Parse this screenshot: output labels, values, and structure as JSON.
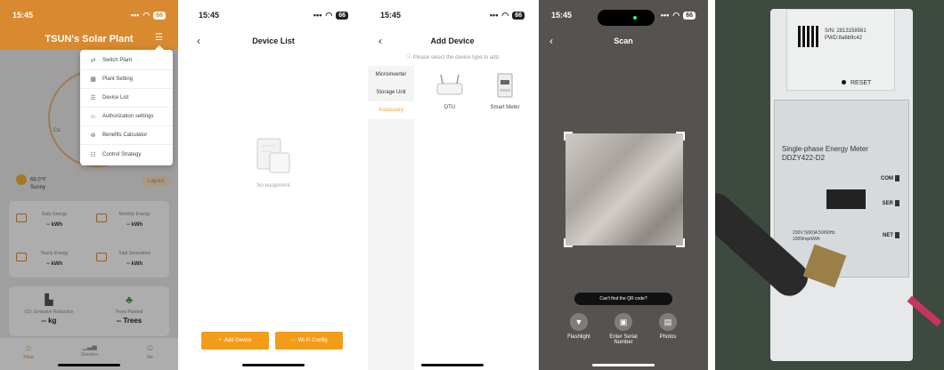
{
  "status_bar": {
    "time": "15:45",
    "signal": "•••",
    "wifi": "◠",
    "battery": "66"
  },
  "panel1": {
    "title": "TSUN's Solar Plant",
    "menu": [
      {
        "icon": "switch-icon",
        "glyph": "⇄",
        "label": "Switch Plant"
      },
      {
        "icon": "plant-setting-icon",
        "glyph": "▦",
        "label": "Plant Setting"
      },
      {
        "icon": "device-list-icon",
        "glyph": "☰",
        "label": "Device List"
      },
      {
        "icon": "user-icon",
        "glyph": "☺",
        "label": "Authorization settings"
      },
      {
        "icon": "calculator-icon",
        "glyph": "⊛",
        "label": "Benefits Calculator"
      },
      {
        "icon": "strategy-icon",
        "glyph": "☷",
        "label": "Control Strategy"
      }
    ],
    "ring_label": "Cu",
    "weather": {
      "temp": "68.0°F",
      "cond": "Sunny"
    },
    "layout_btn": "Layout",
    "stats": [
      {
        "label": "Daily Energy",
        "value": "-- kWh"
      },
      {
        "label": "Monthly Energy",
        "value": "-- kWh"
      },
      {
        "label": "Yearly Energy",
        "value": "-- kWh"
      },
      {
        "label": "Total Generation",
        "value": "-- kWh"
      }
    ],
    "env": [
      {
        "label": "CO₂ Emission Reduction",
        "value": "-- kg"
      },
      {
        "label": "Trees Planted",
        "value": "-- Trees"
      }
    ],
    "tabs": [
      {
        "label": "Plant",
        "glyph": "⌂"
      },
      {
        "label": "Statistics",
        "glyph": "▁▃▅"
      },
      {
        "label": "Me",
        "glyph": "☺"
      }
    ]
  },
  "panel2": {
    "title": "Device List",
    "empty_text": "No equipment",
    "add_device": "Add Device",
    "wifi_config": "Wi-Fi Config"
  },
  "panel3": {
    "title": "Add Device",
    "hint": "Please select the device type to add",
    "sidebar": [
      "Microinverter",
      "Storage Unit",
      "Accessory"
    ],
    "devices": [
      {
        "label": "DTU"
      },
      {
        "label": "Smart Meter"
      }
    ]
  },
  "panel4": {
    "title": "Scan",
    "cant_find": "Can't find the QR code?",
    "actions": [
      {
        "label": "Flashlight",
        "glyph": "▼"
      },
      {
        "label": "Enter Serial Number",
        "glyph": "▣"
      },
      {
        "label": "Photos",
        "glyph": "▤"
      }
    ]
  },
  "panel5": {
    "sn": "S/N: 2813158561",
    "pwd": "PWD:8a6b9c42",
    "reset": "RESET",
    "meter_title_1": "Single-phase Energy Meter",
    "meter_title_2": "DDZY422-D2",
    "com": "COM",
    "ser": "SER",
    "net": "NET",
    "spec": "230V  5(60)A  50/60Hz",
    "spec2": "1000imp/kWh"
  }
}
